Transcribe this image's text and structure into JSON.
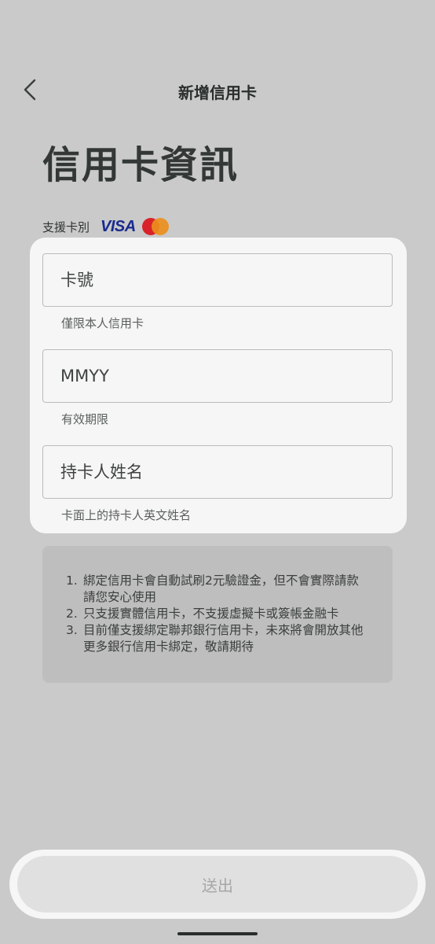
{
  "header": {
    "title": "新增信用卡",
    "back_icon": "chevron-left-icon"
  },
  "page_title": "信用卡資訊",
  "support": {
    "label": "支援卡別",
    "brands": [
      "VISA",
      "Mastercard"
    ],
    "visa_text": "VISA",
    "visa_color": "#1a2a8f",
    "mastercard_colors": [
      "#d8232a",
      "#eb8f1c"
    ]
  },
  "form": {
    "card_number": {
      "placeholder": "卡號",
      "value": "",
      "helper": "僅限本人信用卡"
    },
    "expiry": {
      "placeholder": "MMYY",
      "value": "",
      "helper": "有效期限"
    },
    "holder_name": {
      "placeholder": "持卡人姓名",
      "value": "",
      "helper": "卡面上的持卡人英文姓名"
    }
  },
  "notice": {
    "items": [
      {
        "num": "1.",
        "text": "綁定信用卡會自動試刷2元驗證金，但不會實際請款請您安心使用"
      },
      {
        "num": "2.",
        "text": "只支援實體信用卡，不支援虛擬卡或簽帳金融卡"
      },
      {
        "num": "3.",
        "text": "目前僅支援綁定聯邦銀行信用卡，未來將會開放其他更多銀行信用卡綁定，敬請期待"
      }
    ]
  },
  "submit": {
    "label": "送出",
    "enabled": false
  },
  "colors": {
    "background": "#c9cac9",
    "card": "#f5f6f5",
    "notice_bg": "#bdbebd",
    "submit_disabled_bg": "#dfe0df",
    "submit_disabled_text": "#a5a8a6"
  }
}
